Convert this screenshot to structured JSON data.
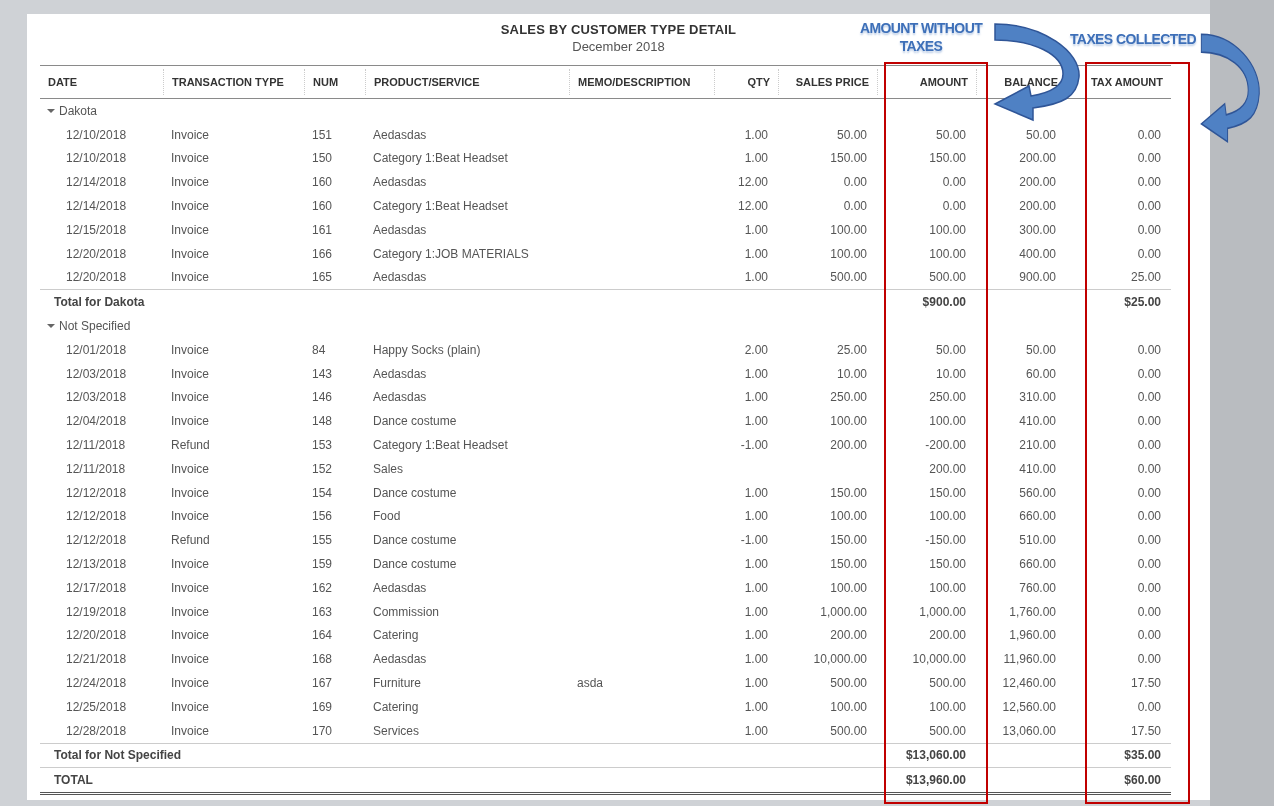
{
  "report": {
    "title": "SALES BY CUSTOMER TYPE DETAIL",
    "period": "December 2018"
  },
  "columns": [
    "DATE",
    "TRANSACTION TYPE",
    "NUM",
    "PRODUCT/SERVICE",
    "MEMO/DESCRIPTION",
    "QTY",
    "SALES PRICE",
    "AMOUNT",
    "BALANCE",
    "TAX AMOUNT"
  ],
  "groups": [
    {
      "name": "Dakota",
      "expanded": true,
      "rows": [
        {
          "date": "12/10/2018",
          "type": "Invoice",
          "num": "151",
          "product": "Aedasdas",
          "qty": "1.00",
          "price": "50.00",
          "amount": "50.00",
          "balance": "50.00",
          "tax": "0.00"
        },
        {
          "date": "12/10/2018",
          "type": "Invoice",
          "num": "150",
          "product": "Category 1:Beat Headset",
          "qty": "1.00",
          "price": "150.00",
          "amount": "150.00",
          "balance": "200.00",
          "tax": "0.00"
        },
        {
          "date": "12/14/2018",
          "type": "Invoice",
          "num": "160",
          "product": "Aedasdas",
          "qty": "12.00",
          "price": "0.00",
          "amount": "0.00",
          "balance": "200.00",
          "tax": "0.00"
        },
        {
          "date": "12/14/2018",
          "type": "Invoice",
          "num": "160",
          "product": "Category 1:Beat Headset",
          "qty": "12.00",
          "price": "0.00",
          "amount": "0.00",
          "balance": "200.00",
          "tax": "0.00"
        },
        {
          "date": "12/15/2018",
          "type": "Invoice",
          "num": "161",
          "product": "Aedasdas",
          "qty": "1.00",
          "price": "100.00",
          "amount": "100.00",
          "balance": "300.00",
          "tax": "0.00"
        },
        {
          "date": "12/20/2018",
          "type": "Invoice",
          "num": "166",
          "product": "Category 1:JOB MATERIALS",
          "qty": "1.00",
          "price": "100.00",
          "amount": "100.00",
          "balance": "400.00",
          "tax": "0.00"
        },
        {
          "date": "12/20/2018",
          "type": "Invoice",
          "num": "165",
          "product": "Aedasdas",
          "qty": "1.00",
          "price": "500.00",
          "amount": "500.00",
          "balance": "900.00",
          "tax": "25.00"
        }
      ],
      "total_label": "Total for Dakota",
      "total_amount": "$900.00",
      "total_tax": "$25.00"
    },
    {
      "name": "Not Specified",
      "expanded": true,
      "rows": [
        {
          "date": "12/01/2018",
          "type": "Invoice",
          "num": "84",
          "product": "Happy Socks (plain)",
          "qty": "2.00",
          "price": "25.00",
          "amount": "50.00",
          "balance": "50.00",
          "tax": "0.00"
        },
        {
          "date": "12/03/2018",
          "type": "Invoice",
          "num": "143",
          "product": "Aedasdas",
          "qty": "1.00",
          "price": "10.00",
          "amount": "10.00",
          "balance": "60.00",
          "tax": "0.00"
        },
        {
          "date": "12/03/2018",
          "type": "Invoice",
          "num": "146",
          "product": "Aedasdas",
          "qty": "1.00",
          "price": "250.00",
          "amount": "250.00",
          "balance": "310.00",
          "tax": "0.00"
        },
        {
          "date": "12/04/2018",
          "type": "Invoice",
          "num": "148",
          "product": "Dance costume",
          "qty": "1.00",
          "price": "100.00",
          "amount": "100.00",
          "balance": "410.00",
          "tax": "0.00"
        },
        {
          "date": "12/11/2018",
          "type": "Refund",
          "num": "153",
          "product": "Category 1:Beat Headset",
          "qty": "-1.00",
          "price": "200.00",
          "amount": "-200.00",
          "balance": "210.00",
          "tax": "0.00"
        },
        {
          "date": "12/11/2018",
          "type": "Invoice",
          "num": "152",
          "product": "Sales",
          "amount": "200.00",
          "balance": "410.00",
          "tax": "0.00"
        },
        {
          "date": "12/12/2018",
          "type": "Invoice",
          "num": "154",
          "product": "Dance costume",
          "qty": "1.00",
          "price": "150.00",
          "amount": "150.00",
          "balance": "560.00",
          "tax": "0.00"
        },
        {
          "date": "12/12/2018",
          "type": "Invoice",
          "num": "156",
          "product": "Food",
          "qty": "1.00",
          "price": "100.00",
          "amount": "100.00",
          "balance": "660.00",
          "tax": "0.00"
        },
        {
          "date": "12/12/2018",
          "type": "Refund",
          "num": "155",
          "product": "Dance costume",
          "qty": "-1.00",
          "price": "150.00",
          "amount": "-150.00",
          "balance": "510.00",
          "tax": "0.00"
        },
        {
          "date": "12/13/2018",
          "type": "Invoice",
          "num": "159",
          "product": "Dance costume",
          "qty": "1.00",
          "price": "150.00",
          "amount": "150.00",
          "balance": "660.00",
          "tax": "0.00"
        },
        {
          "date": "12/17/2018",
          "type": "Invoice",
          "num": "162",
          "product": "Aedasdas",
          "qty": "1.00",
          "price": "100.00",
          "amount": "100.00",
          "balance": "760.00",
          "tax": "0.00"
        },
        {
          "date": "12/19/2018",
          "type": "Invoice",
          "num": "163",
          "product": "Commission",
          "qty": "1.00",
          "price": "1,000.00",
          "amount": "1,000.00",
          "balance": "1,760.00",
          "tax": "0.00"
        },
        {
          "date": "12/20/2018",
          "type": "Invoice",
          "num": "164",
          "product": "Catering",
          "qty": "1.00",
          "price": "200.00",
          "amount": "200.00",
          "balance": "1,960.00",
          "tax": "0.00"
        },
        {
          "date": "12/21/2018",
          "type": "Invoice",
          "num": "168",
          "product": "Aedasdas",
          "qty": "1.00",
          "price": "10,000.00",
          "amount": "10,000.00",
          "balance": "11,960.00",
          "tax": "0.00"
        },
        {
          "date": "12/24/2018",
          "type": "Invoice",
          "num": "167",
          "product": "Furniture",
          "memo": "asda",
          "qty": "1.00",
          "price": "500.00",
          "amount": "500.00",
          "balance": "12,460.00",
          "tax": "17.50"
        },
        {
          "date": "12/25/2018",
          "type": "Invoice",
          "num": "169",
          "product": "Catering",
          "qty": "1.00",
          "price": "100.00",
          "amount": "100.00",
          "balance": "12,560.00",
          "tax": "0.00"
        },
        {
          "date": "12/28/2018",
          "type": "Invoice",
          "num": "170",
          "product": "Services",
          "qty": "1.00",
          "price": "500.00",
          "amount": "500.00",
          "balance": "13,060.00",
          "tax": "17.50"
        }
      ],
      "total_label": "Total for Not Specified",
      "total_amount": "$13,060.00",
      "total_tax": "$35.00"
    }
  ],
  "grand_total": {
    "label": "TOTAL",
    "amount": "$13,960.00",
    "tax": "$60.00"
  },
  "annotations": [
    {
      "text": "AMOUNT WITHOUT TAXES"
    },
    {
      "text": "TAXES COLLECTED"
    }
  ]
}
